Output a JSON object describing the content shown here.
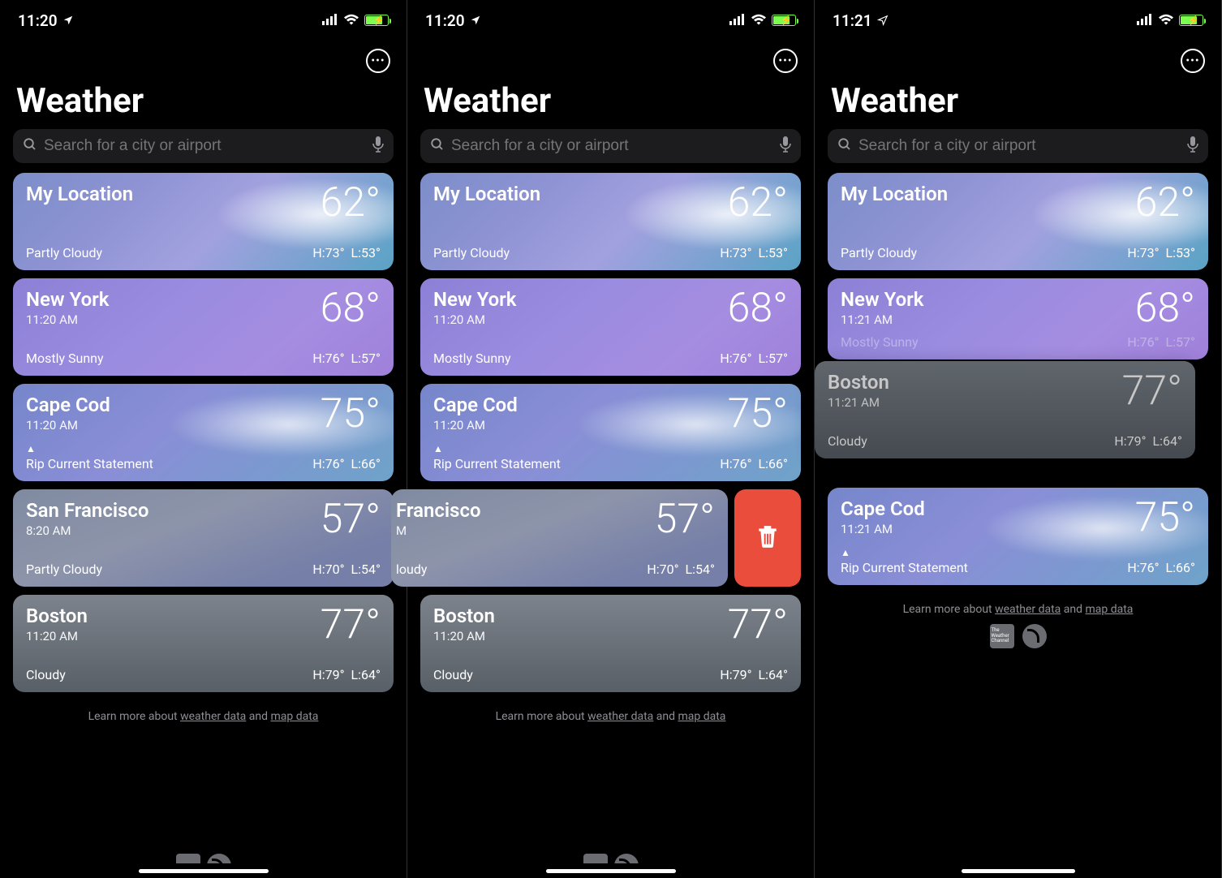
{
  "screens": [
    {
      "status": {
        "time": "11:20"
      },
      "title": "Weather",
      "search_placeholder": "Search for a city or airport",
      "cards": [
        {
          "name": "My Location",
          "subtitle": "",
          "cond": "Partly Cloudy",
          "temp": "62°",
          "hi": "H:73°",
          "lo": "L:53°"
        },
        {
          "name": "New York",
          "subtitle": "11:20 AM",
          "cond": "Mostly Sunny",
          "temp": "68°",
          "hi": "H:76°",
          "lo": "L:57°"
        },
        {
          "name": "Cape Cod",
          "subtitle": "11:20 AM",
          "cond": "Rip Current Statement",
          "temp": "75°",
          "hi": "H:76°",
          "lo": "L:66°",
          "alert": true
        },
        {
          "name": "San Francisco",
          "subtitle": "8:20 AM",
          "cond": "Partly Cloudy",
          "temp": "57°",
          "hi": "H:70°",
          "lo": "L:54°"
        },
        {
          "name": "Boston",
          "subtitle": "11:20 AM",
          "cond": "Cloudy",
          "temp": "77°",
          "hi": "H:79°",
          "lo": "L:64°"
        }
      ],
      "footer": {
        "pre": "Learn more about ",
        "link1": "weather data",
        "and": " and ",
        "link2": "map data"
      }
    },
    {
      "status": {
        "time": "11:20"
      },
      "title": "Weather",
      "search_placeholder": "Search for a city or airport",
      "cards": [
        {
          "name": "My Location",
          "subtitle": "",
          "cond": "Partly Cloudy",
          "temp": "62°",
          "hi": "H:73°",
          "lo": "L:53°"
        },
        {
          "name": "New York",
          "subtitle": "11:20 AM",
          "cond": "Mostly Sunny",
          "temp": "68°",
          "hi": "H:76°",
          "lo": "L:57°"
        },
        {
          "name": "Cape Cod",
          "subtitle": "11:20 AM",
          "cond": "Rip Current Statement",
          "temp": "75°",
          "hi": "H:76°",
          "lo": "L:66°",
          "alert": true
        },
        {
          "name": "Francisco",
          "subtitle": "M",
          "cond": "loudy",
          "temp": "57°",
          "hi": "H:70°",
          "lo": "L:54°"
        },
        {
          "name": "Boston",
          "subtitle": "11:20 AM",
          "cond": "Cloudy",
          "temp": "77°",
          "hi": "H:79°",
          "lo": "L:64°"
        }
      ],
      "footer": {
        "pre": "Learn more about ",
        "link1": "weather data",
        "and": " and ",
        "link2": "map data"
      }
    },
    {
      "status": {
        "time": "11:21"
      },
      "title": "Weather",
      "search_placeholder": "Search for a city or airport",
      "cards": [
        {
          "name": "My Location",
          "subtitle": "",
          "cond": "Partly Cloudy",
          "temp": "62°",
          "hi": "H:73°",
          "lo": "L:53°"
        },
        {
          "name": "New York",
          "subtitle": "11:21 AM",
          "cond": "Mostly Sunny",
          "temp": "68°",
          "hi": "H:76°",
          "lo": "L:57°"
        },
        {
          "name": "Boston",
          "subtitle": "11:21 AM",
          "cond": "Cloudy",
          "temp": "77°",
          "hi": "H:79°",
          "lo": "L:64°"
        },
        {
          "name": "Cape Cod",
          "subtitle": "11:21 AM",
          "cond": "Rip Current Statement",
          "temp": "75°",
          "hi": "H:76°",
          "lo": "L:66°",
          "alert": true
        }
      ],
      "footer": {
        "pre": "Learn more about ",
        "link1": "weather data",
        "and": " and ",
        "link2": "map data"
      },
      "show_logos": true
    }
  ],
  "alert_symbol": "▲",
  "twc_label": "The Weather Channel"
}
